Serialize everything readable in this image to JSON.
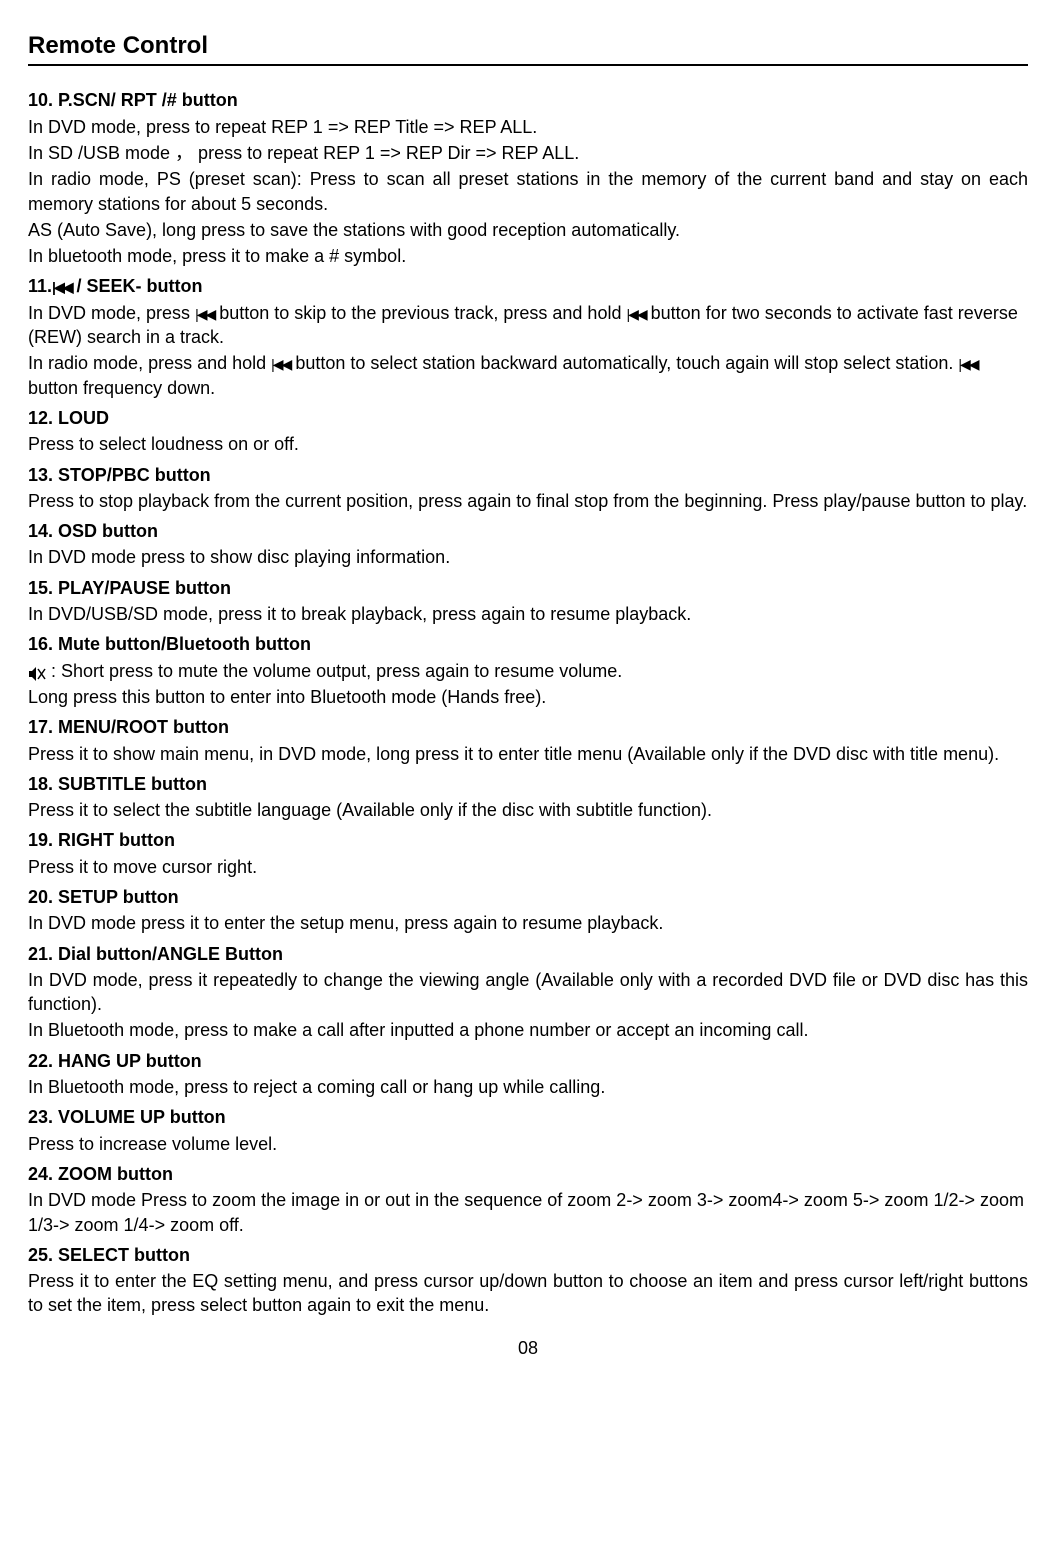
{
  "pageTitle": "Remote Control",
  "pageNumber": "08",
  "sections": {
    "s10": {
      "heading": "10. P.SCN/ RPT /# button",
      "p1": "In DVD mode, press to repeat REP 1 => REP Title => REP ALL.",
      "p2": "In SD /USB mode ， press to repeat REP 1 => REP Dir => REP ALL.",
      "p3": "In radio mode, PS (preset scan): Press to scan all preset stations in the memory of the current band and stay on each memory stations for about 5 seconds.",
      "p4": "AS (Auto Save), long press to save the stations with good reception automatically.",
      "p5": "In bluetooth mode, press it to make a # symbol."
    },
    "s11": {
      "heading_pre": "11.",
      "heading_post": " / SEEK- button",
      "p1_pre": "In DVD mode, press ",
      "p1_mid": " button to skip to the previous track, press and hold ",
      "p1_post": " button for two seconds to activate fast reverse (REW) search in a track.",
      "p2_pre": "In radio mode, press and hold ",
      "p2_mid": " button to select station backward automatically, touch again will stop select station. ",
      "p2_post": " button frequency down."
    },
    "s12": {
      "heading": "12. LOUD",
      "p1": "Press to select loudness on or off."
    },
    "s13": {
      "heading": "13. STOP/PBC button",
      "p1": "Press to stop playback from the current position, press again to final stop from the beginning. Press play/pause button to play."
    },
    "s14": {
      "heading": "14. OSD button",
      "p1": "In DVD mode press to show disc playing information."
    },
    "s15": {
      "heading": "15. PLAY/PAUSE button",
      "p1": "In DVD/USB/SD mode, press it to break playback, press again to resume playback."
    },
    "s16": {
      "heading": "16. Mute button/Bluetooth button",
      "p1_post": " : Short press to mute the volume output, press again to resume volume.",
      "p2": "Long press this button to enter into Bluetooth mode (Hands free)."
    },
    "s17": {
      "heading": "17. MENU/ROOT button",
      "p1": "Press it to show main menu, in DVD mode, long press it to enter title menu (Available only if the DVD disc with title menu)."
    },
    "s18": {
      "heading": "18. SUBTITLE button",
      "p1": "Press it to select the subtitle language (Available only if the disc with subtitle function)."
    },
    "s19": {
      "heading": "19. RIGHT button",
      "p1": "Press it to move cursor right."
    },
    "s20": {
      "heading": "20. SETUP button",
      "p1": "In DVD mode press it to enter the setup menu, press again to resume playback."
    },
    "s21": {
      "heading": "21. Dial button/ANGLE Button",
      "p1": "In DVD mode, press it repeatedly to change the viewing angle (Available only with a recorded DVD file or DVD disc has this function).",
      "p2": "In Bluetooth mode, press to make a call after inputted a phone number or accept an incoming call."
    },
    "s22": {
      "heading": "22. HANG UP button",
      "p1": "In Bluetooth mode, press to reject a coming call or hang up while calling."
    },
    "s23": {
      "heading": "23. VOLUME UP button",
      "p1": "Press to increase volume level."
    },
    "s24": {
      "heading": "24. ZOOM button",
      "p1": "In DVD mode Press to zoom the image in or out in the sequence of zoom 2-> zoom 3-> zoom4-> zoom 5-> zoom 1/2-> zoom 1/3-> zoom 1/4-> zoom off."
    },
    "s25": {
      "heading": "25. SELECT button",
      "p1": "Press it to enter the EQ setting menu, and press cursor up/down button to choose an item and press cursor left/right buttons to set the item, press select button again to exit the menu."
    }
  }
}
